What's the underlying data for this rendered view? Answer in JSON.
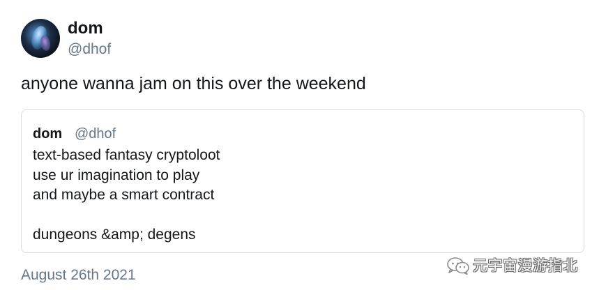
{
  "tweet": {
    "author_name": "dom",
    "author_handle": "@dhof",
    "text": "anyone wanna jam on this over the weekend",
    "date": "August 26th 2021"
  },
  "quoted_tweet": {
    "author_name": "dom",
    "author_handle": "@dhof",
    "lines": [
      "text-based fantasy cryptoloot",
      "use ur imagination to play",
      "and maybe a smart contract",
      "",
      "dungeons &amp; degens"
    ]
  },
  "watermark": {
    "icon": "wechat-icon",
    "text": "元宇宙漫游指北"
  },
  "colors": {
    "text_primary": "#14171a",
    "text_secondary": "#657786",
    "border": "#d8dde1",
    "background": "#ffffff"
  }
}
